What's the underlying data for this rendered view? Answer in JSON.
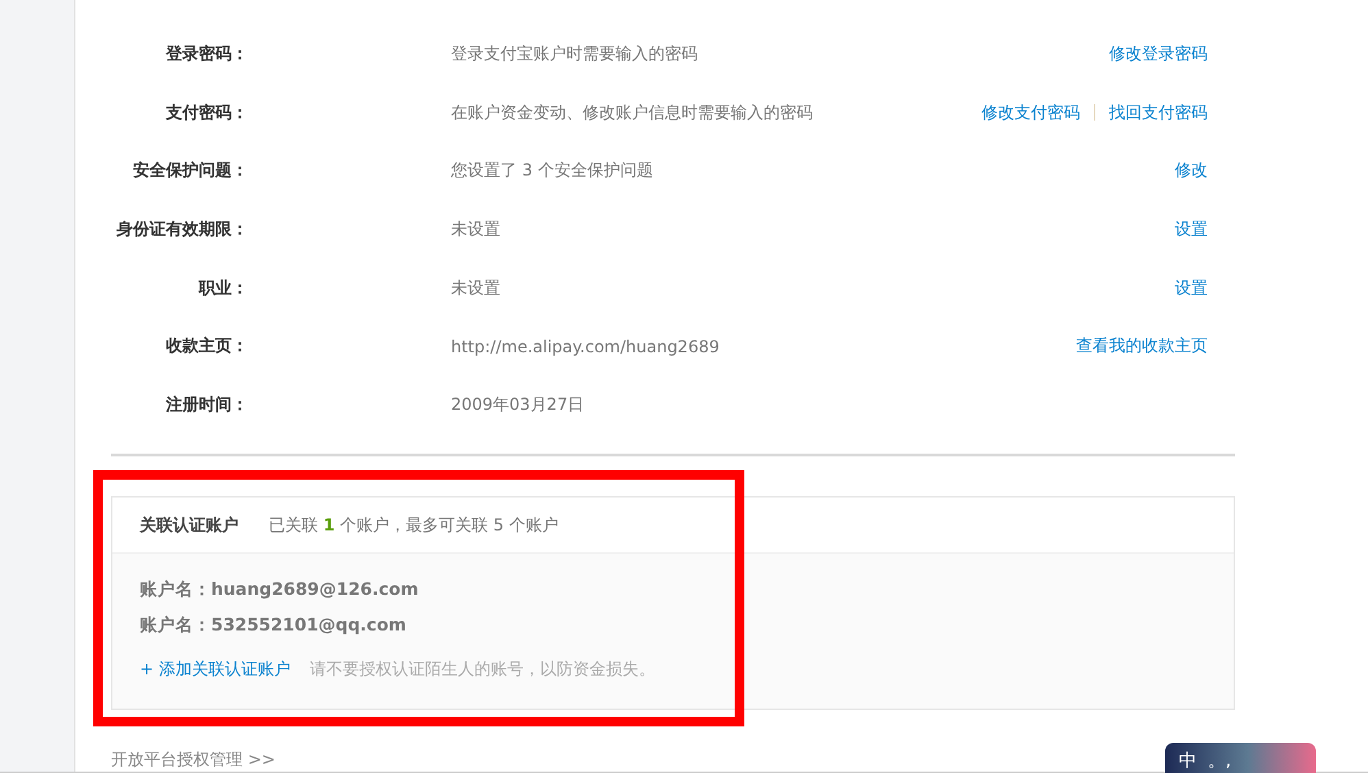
{
  "info_rows": [
    {
      "label": "登录密码：",
      "value": "登录支付宝账户时需要输入的密码",
      "actions": [
        "修改登录密码"
      ]
    },
    {
      "label": "支付密码：",
      "value": "在账户资金变动、修改账户信息时需要输入的密码",
      "actions": [
        "修改支付密码",
        "找回支付密码"
      ]
    },
    {
      "label": "安全保护问题：",
      "value": "您设置了 3 个安全保护问题",
      "actions": [
        "修改"
      ]
    },
    {
      "label": "身份证有效期限：",
      "value": "未设置",
      "actions": [
        "设置"
      ]
    },
    {
      "label": "职业：",
      "value": "未设置",
      "actions": [
        "设置"
      ]
    },
    {
      "label": "收款主页：",
      "value": "http://me.alipay.com/huang2689",
      "actions": [
        "查看我的收款主页"
      ]
    },
    {
      "label": "注册时间：",
      "value": "2009年03月27日",
      "actions": []
    }
  ],
  "linked_accounts": {
    "title": "关联认证账户",
    "summary": "已关联 **1** 个账户，最多可关联 5 个账户",
    "accounts": [
      "账户名：huang2689@126.com",
      "账户名：532552101@qq.com"
    ],
    "add_link": "+ 添加关联认证账户",
    "hint": "请不要授权认证陌生人的账号，以防资金损失。"
  },
  "footer_link": "开放平台授权管理 >>",
  "ime_bar": {
    "mode": "中",
    "punctuation": "。,"
  }
}
